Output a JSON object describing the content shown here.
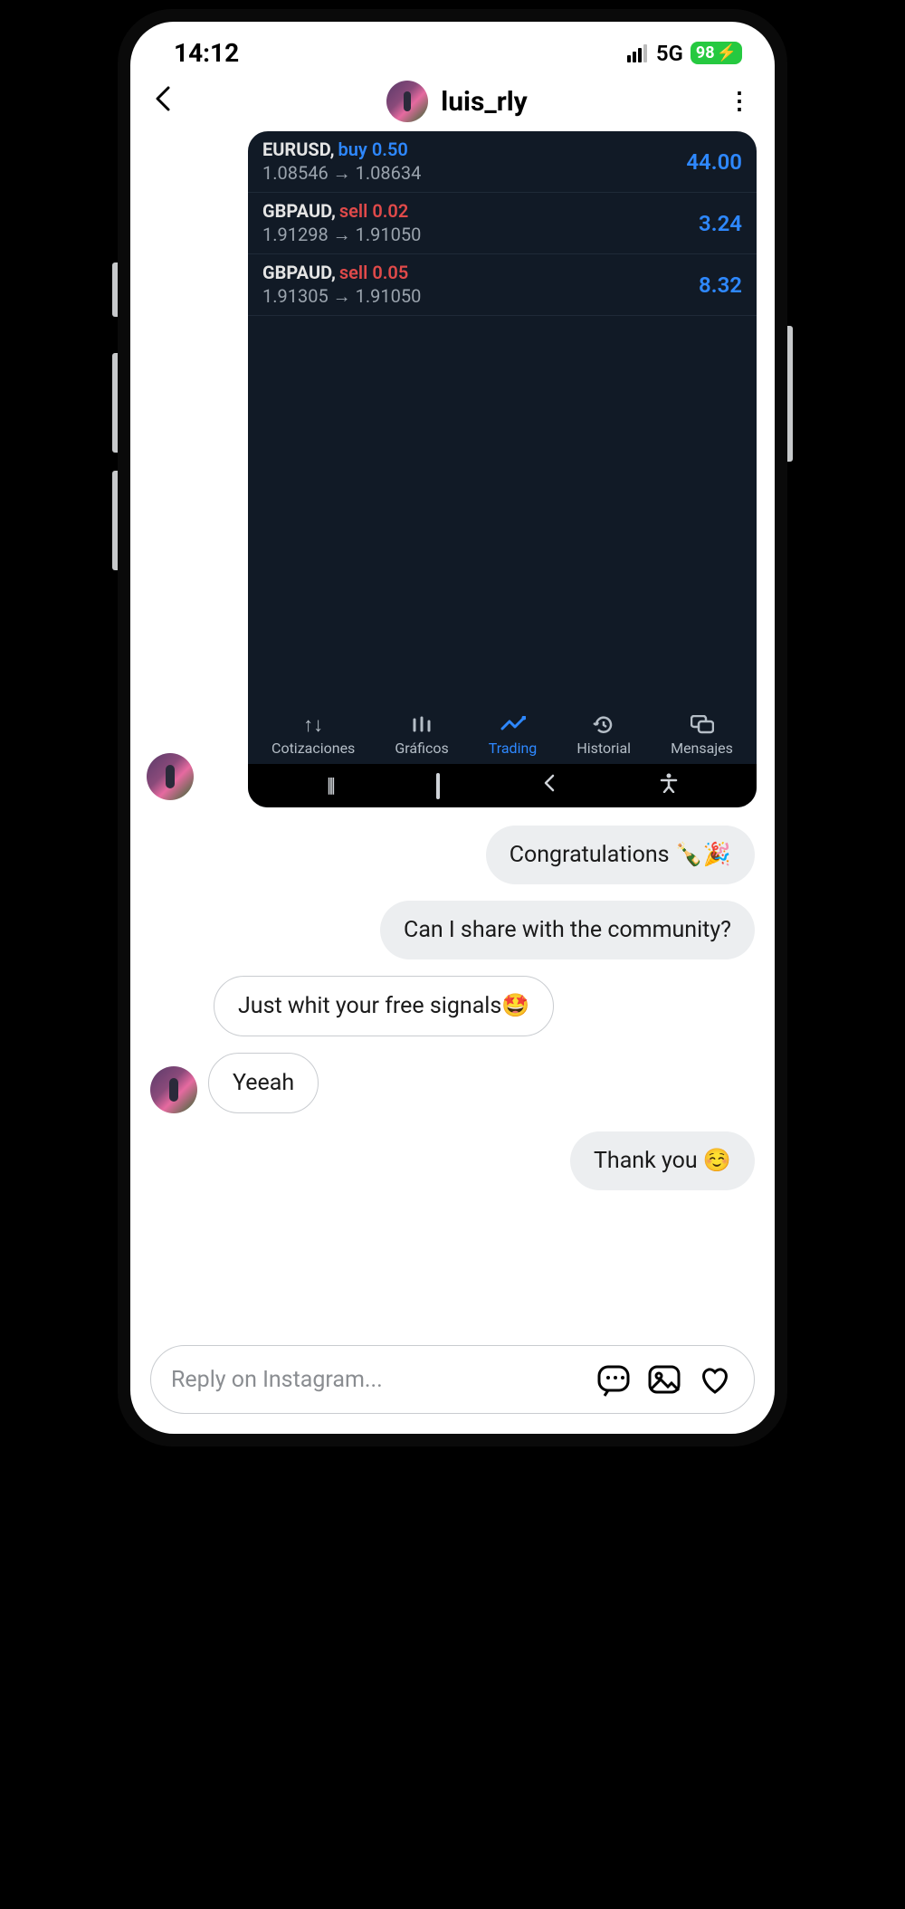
{
  "status": {
    "time": "14:12",
    "network": "5G",
    "battery": "98"
  },
  "header": {
    "username": "luis_rly"
  },
  "embedded": {
    "trades": [
      {
        "pair": "EURUSD",
        "dir": "buy",
        "volume": "0.50",
        "p1": "1.08546",
        "p2": "1.08634",
        "value": "44.00"
      },
      {
        "pair": "GBPAUD",
        "dir": "sell",
        "volume": "0.02",
        "p1": "1.91298",
        "p2": "1.91050",
        "value": "3.24"
      },
      {
        "pair": "GBPAUD",
        "dir": "sell",
        "volume": "0.05",
        "p1": "1.91305",
        "p2": "1.91050",
        "value": "8.32"
      }
    ],
    "tabs": {
      "cotizaciones": "Cotizaciones",
      "graficos": "Gráficos",
      "trading": "Trading",
      "historial": "Historial",
      "mensajes": "Mensajes"
    }
  },
  "messages": {
    "m1": "Congratulations 🍾🎉",
    "m2": "Can I share with the community?",
    "m3": "Just whit your free signals🤩",
    "m4": "Yeeah",
    "m5": "Thank you ☺️"
  },
  "input": {
    "placeholder": "Reply on Instagram..."
  }
}
